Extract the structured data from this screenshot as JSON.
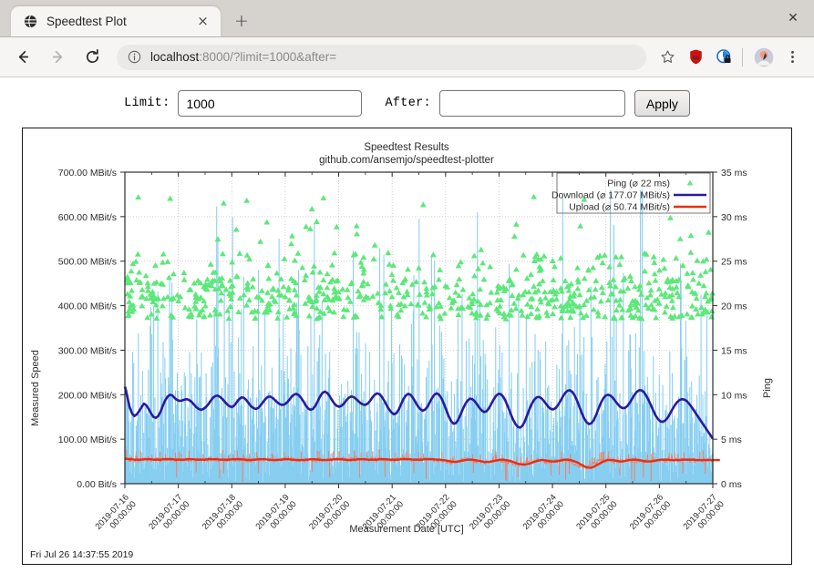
{
  "browser": {
    "tab": {
      "title": "Speedtest Plot",
      "favicon": "globe-icon",
      "close_label": "×"
    },
    "new_tab_label": "+",
    "window_close_label": "✕",
    "toolbar": {
      "back_label": "←",
      "forward_label": "→",
      "reload_label": "↻",
      "url_host": "localhost",
      "url_rest": ":8000/?limit=1000&after=",
      "url_full": "localhost:8000/?limit=1000&after=",
      "info_icon": "info-circle-icon",
      "bookmark_icon": "star-icon",
      "ublock_icon": "ublock-shield-icon",
      "privacy_icon": "privacy-badger-icon",
      "profile_icon": "avatar-icon",
      "menu_icon": "kebab-menu-icon"
    }
  },
  "form": {
    "limit_label": "Limit:",
    "limit_value": "1000",
    "limit_placeholder": "",
    "after_label": "After:",
    "after_value": "",
    "after_placeholder": "",
    "apply_label": "Apply"
  },
  "footer": {
    "timestamp": "Fri Jul 26 14:37:55 2019"
  },
  "colors": {
    "ping": "#5ce87a",
    "download_raw": "#87cef0",
    "download_smooth": "#2a1a9e",
    "upload_raw": "#fa7a5a",
    "upload_smooth": "#ef2c10",
    "axis": "#2b2b2b",
    "grid": "#bfbfbf"
  },
  "chart_data": {
    "type": "line",
    "title": "Speedtest Results",
    "subtitle": "github.com/ansemjo/speedtest-plotter",
    "xlabel": "Measurement Date [UTC]",
    "ylabel": "Measured Speed",
    "y2label": "Ping",
    "grid": true,
    "legend_position": "top-right",
    "x_ticks": [
      "2019-07-16\n00:00:00",
      "2019-07-17\n00:00:00",
      "2019-07-18\n00:00:00",
      "2019-07-19\n00:00:00",
      "2019-07-20\n00:00:00",
      "2019-07-21\n00:00:00",
      "2019-07-22\n00:00:00",
      "2019-07-23\n00:00:00",
      "2019-07-24\n00:00:00",
      "2019-07-25\n00:00:00",
      "2019-07-26\n00:00:00",
      "2019-07-27\n00:00:00"
    ],
    "y_ticks": [
      "0.00  Bit/s",
      "100.00 MBit/s",
      "200.00 MBit/s",
      "300.00 MBit/s",
      "400.00 MBit/s",
      "500.00 MBit/s",
      "600.00 MBit/s",
      "700.00 MBit/s"
    ],
    "ylim": [
      0,
      700
    ],
    "y2_ticks": [
      "0 ms",
      "5 ms",
      "10 ms",
      "15 ms",
      "20 ms",
      "25 ms",
      "30 ms",
      "35 ms"
    ],
    "y2lim": [
      0,
      35
    ],
    "xlim": [
      "2019-07-15 12:00:00",
      "2019-07-27 00:00:00"
    ],
    "legend": [
      {
        "name": "Ping (⌀ 22 ms)",
        "marker": "triangle",
        "color": "#5ce87a",
        "mean": 22,
        "unit": "ms"
      },
      {
        "name": "Download (⌀ 177.07 MBit/s)",
        "marker": "line",
        "color": "#2a1a9e",
        "mean": 177.07,
        "unit": "MBit/s"
      },
      {
        "name": "Upload (⌀ 50.74 MBit/s)",
        "marker": "line",
        "color": "#ef2c10",
        "mean": 50.74,
        "unit": "MBit/s"
      }
    ],
    "series": [
      {
        "name": "Download (smoothed)",
        "type": "line",
        "color": "#2a1a9e",
        "axis": "left",
        "values": [
          218,
          196,
          172,
          158,
          152,
          156,
          163,
          172,
          180,
          176,
          168,
          158,
          150,
          148,
          152,
          162,
          176,
          188,
          196,
          200,
          198,
          192,
          188,
          186,
          187,
          189,
          190,
          188,
          184,
          178,
          172,
          168,
          166,
          168,
          172,
          178,
          186,
          193,
          197,
          198,
          195,
          190,
          184,
          178,
          174,
          172,
          176,
          183,
          190,
          194,
          193,
          188,
          181,
          174,
          170,
          168,
          170,
          176,
          183,
          190,
          195,
          196,
          193,
          188,
          183,
          179,
          177,
          178,
          182,
          188,
          195,
          200,
          202,
          199,
          193,
          185,
          176,
          169,
          166,
          168,
          175,
          185,
          196,
          204,
          207,
          204,
          197,
          188,
          180,
          175,
          173,
          175,
          180,
          187,
          193,
          196,
          195,
          191,
          186,
          181,
          178,
          177,
          180,
          186,
          194,
          200,
          203,
          201,
          195,
          186,
          176,
          167,
          160,
          156,
          158,
          166,
          178,
          190,
          198,
          202,
          200,
          193,
          184,
          175,
          168,
          164,
          166,
          172,
          182,
          192,
          200,
          203,
          200,
          192,
          180,
          166,
          152,
          141,
          135,
          136,
          143,
          155,
          168,
          179,
          187,
          191,
          190,
          185,
          178,
          170,
          164,
          161,
          163,
          170,
          180,
          190,
          198,
          202,
          201,
          195,
          185,
          172,
          158,
          145,
          135,
          128,
          126,
          130,
          140,
          154,
          168,
          180,
          189,
          194,
          195,
          192,
          186,
          179,
          172,
          168,
          167,
          170,
          177,
          186,
          196,
          204,
          209,
          210,
          206,
          198,
          186,
          172,
          158,
          146,
          138,
          134,
          136,
          143,
          155,
          169,
          182,
          192,
          198,
          200,
          198,
          193,
          186,
          179,
          173,
          170,
          170,
          174,
          181,
          190,
          199,
          206,
          210,
          210,
          206,
          198,
          188,
          176,
          164,
          153,
          145,
          140,
          139,
          142,
          148,
          157,
          167,
          176,
          183,
          188,
          190,
          189,
          186,
          180,
          173,
          165,
          157,
          149,
          141,
          133,
          125,
          117,
          109,
          101
        ]
      },
      {
        "name": "Upload (smoothed)",
        "type": "line",
        "color": "#ef2c10",
        "axis": "left",
        "values": [
          56,
          56,
          55,
          55,
          54,
          54,
          54,
          54,
          55,
          55,
          55,
          55,
          54,
          54,
          54,
          54,
          55,
          55,
          55,
          55,
          55,
          54,
          54,
          54,
          54,
          54,
          55,
          55,
          55,
          55,
          54,
          54,
          54,
          54,
          54,
          55,
          55,
          55,
          55,
          55,
          54,
          54,
          54,
          54,
          54,
          55,
          55,
          55,
          55,
          55,
          54,
          54,
          53,
          53,
          54,
          54,
          55,
          55,
          55,
          55,
          54,
          54,
          53,
          53,
          53,
          54,
          54,
          55,
          55,
          55,
          54,
          54,
          53,
          53,
          53,
          53,
          54,
          54,
          55,
          55,
          55,
          54,
          54,
          53,
          53,
          53,
          54,
          54,
          55,
          55,
          55,
          55,
          54,
          54,
          53,
          53,
          54,
          54,
          55,
          55,
          55,
          55,
          54,
          54,
          54,
          54,
          54,
          55,
          55,
          55,
          55,
          54,
          54,
          54,
          54,
          54,
          55,
          55,
          55,
          55,
          55,
          54,
          54,
          54,
          54,
          54,
          55,
          55,
          55,
          55,
          55,
          54,
          54,
          53,
          53,
          52,
          51,
          50,
          49,
          49,
          50,
          51,
          52,
          53,
          54,
          54,
          54,
          53,
          52,
          51,
          50,
          49,
          49,
          49,
          50,
          51,
          52,
          53,
          54,
          54,
          53,
          52,
          51,
          49,
          47,
          45,
          44,
          43,
          43,
          44,
          45,
          47,
          49,
          51,
          52,
          53,
          53,
          52,
          51,
          50,
          50,
          50,
          51,
          52,
          53,
          54,
          54,
          53,
          52,
          50,
          48,
          45,
          42,
          39,
          37,
          36,
          36,
          38,
          41,
          44,
          47,
          50,
          52,
          53,
          53,
          53,
          52,
          51,
          50,
          50,
          51,
          52,
          53,
          54,
          54,
          54,
          53,
          52,
          51,
          50,
          50,
          50,
          51,
          52,
          53,
          54,
          54,
          54,
          54,
          53,
          53,
          53,
          53,
          53,
          54,
          54,
          54,
          54,
          54,
          54,
          53,
          53,
          53,
          53,
          53,
          53,
          53,
          53,
          53,
          53,
          53
        ]
      },
      {
        "name": "Download (raw)",
        "type": "impulse",
        "color": "#87cef0",
        "axis": "left",
        "note": "dense per-measurement vertical lines, range 0–660 MBit/s"
      },
      {
        "name": "Upload (raw)",
        "type": "impulse",
        "color": "#fa7a5a",
        "axis": "left",
        "note": "dense per-measurement vertical lines, around 50 MBit/s"
      },
      {
        "name": "Ping",
        "type": "scatter",
        "color": "#5ce87a",
        "axis": "right",
        "marker": "triangle",
        "note": "scatter cloud mostly between 18 and 25 ms, outliers to 32 ms"
      }
    ]
  }
}
